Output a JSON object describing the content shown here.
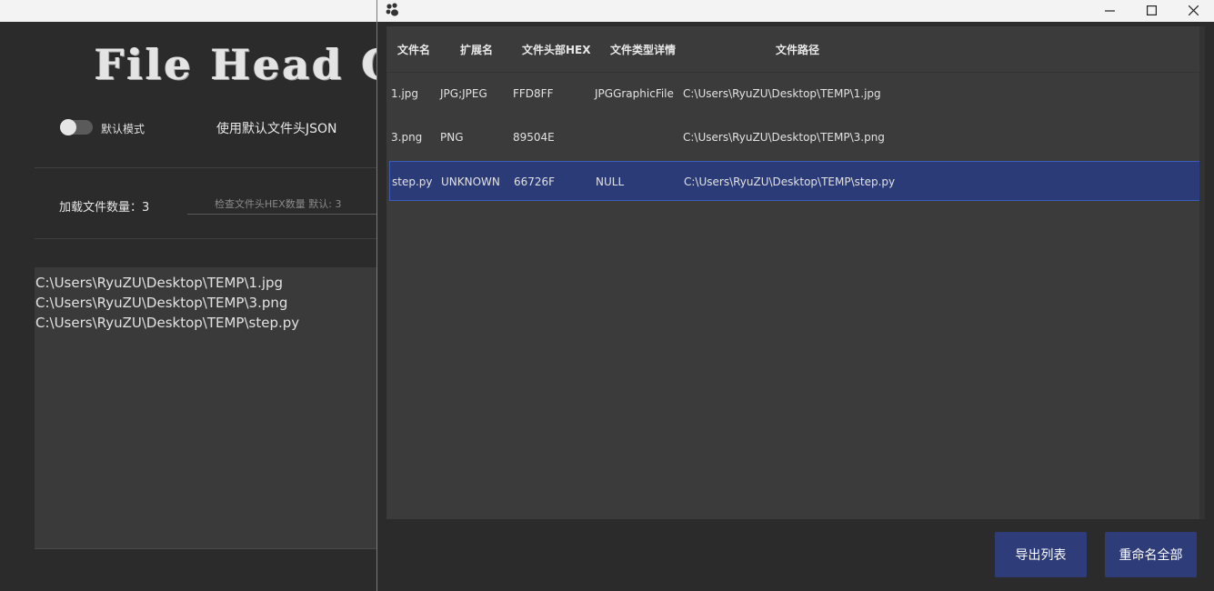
{
  "back_window": {
    "app_title": "File Head Chec",
    "mode_toggle": {
      "label": "默认模式",
      "on": false
    },
    "json_label": "使用默认文件头JSON",
    "file_count": "加载文件数量：3",
    "hex_input": {
      "placeholder": "检查文件头HEX数量 默认: 3",
      "value": ""
    },
    "paths": [
      "C:\\Users\\RyuZU\\Desktop\\TEMP\\1.jpg",
      "C:\\Users\\RyuZU\\Desktop\\TEMP\\3.png",
      "C:\\Users\\RyuZU\\Desktop\\TEMP\\step.py"
    ]
  },
  "front_window": {
    "controls": {
      "minimize": "minimize-icon",
      "maximize": "maximize-icon",
      "close": "close-icon"
    },
    "table": {
      "headers": [
        "文件名",
        "扩展名",
        "文件头部HEX",
        "文件类型详情",
        "文件路径"
      ],
      "rows": [
        {
          "name": "1.jpg",
          "ext": "JPG;JPEG",
          "hex": "FFD8FF",
          "detail": "JPGGraphicFile",
          "path": "C:\\Users\\RyuZU\\Desktop\\TEMP\\1.jpg",
          "selected": false
        },
        {
          "name": "3.png",
          "ext": "PNG",
          "hex": "89504E",
          "detail": "",
          "path": "C:\\Users\\RyuZU\\Desktop\\TEMP\\3.png",
          "selected": false
        },
        {
          "name": "step.py",
          "ext": "UNKNOWN",
          "hex": "66726F",
          "detail": "NULL",
          "path": "C:\\Users\\RyuZU\\Desktop\\TEMP\\step.py",
          "selected": true
        }
      ]
    },
    "buttons": {
      "export": "导出列表",
      "rename_all": "重命名全部"
    }
  },
  "colors": {
    "background": "#2b2b2b",
    "panel": "#3b3b3b",
    "selection": "#2b3b78",
    "selection_border": "#3d5bb8",
    "button": "#2e3d7a",
    "titlebar": "#f3f3f3"
  }
}
